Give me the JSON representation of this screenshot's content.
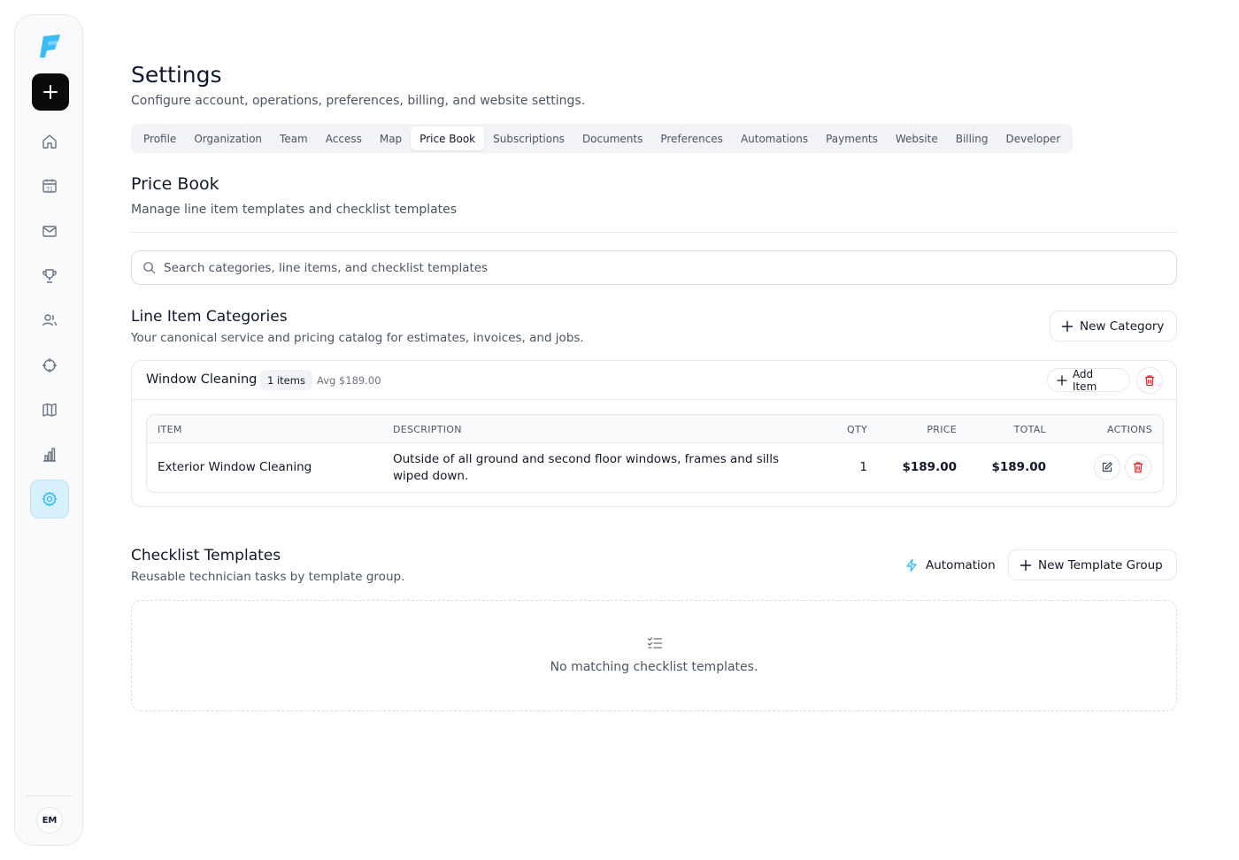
{
  "sidebar": {
    "nav_icons": [
      "home-icon",
      "calendar-icon",
      "mail-icon",
      "trophy-icon",
      "users-icon",
      "target-icon",
      "map-icon",
      "chart-icon",
      "settings-icon"
    ],
    "calendar_day": "31",
    "avatar_initials": "EM",
    "accent_color": "#38bdf8"
  },
  "header": {
    "title": "Settings",
    "subtitle": "Configure account, operations, preferences, billing, and website settings."
  },
  "tabs": [
    {
      "label": "Profile",
      "active": false
    },
    {
      "label": "Organization",
      "active": false
    },
    {
      "label": "Team",
      "active": false
    },
    {
      "label": "Access",
      "active": false
    },
    {
      "label": "Map",
      "active": false
    },
    {
      "label": "Price Book",
      "active": true
    },
    {
      "label": "Subscriptions",
      "active": false
    },
    {
      "label": "Documents",
      "active": false
    },
    {
      "label": "Preferences",
      "active": false
    },
    {
      "label": "Automations",
      "active": false
    },
    {
      "label": "Payments",
      "active": false
    },
    {
      "label": "Website",
      "active": false
    },
    {
      "label": "Billing",
      "active": false
    },
    {
      "label": "Developer",
      "active": false
    }
  ],
  "price_book": {
    "title": "Price Book",
    "subtitle": "Manage line item templates and checklist templates",
    "search_placeholder": "Search categories, line items, and checklist templates"
  },
  "line_items": {
    "title": "Line Item Categories",
    "subtitle": "Your canonical service and pricing catalog for estimates, invoices, and jobs.",
    "new_category_label": "New Category",
    "category": {
      "name": "Window Cleaning",
      "items_badge": "1 items",
      "avg": "Avg $189.00",
      "add_item_label": "Add Item"
    },
    "table": {
      "headers": {
        "item": "ITEM",
        "description": "DESCRIPTION",
        "qty": "QTY",
        "price": "PRICE",
        "total": "TOTAL",
        "actions": "ACTIONS"
      },
      "rows": [
        {
          "item": "Exterior Window Cleaning",
          "description_line1": "Outside of all ground and second floor windows, frames and sills",
          "description_line2": "wiped down.",
          "qty": "1",
          "price": "$189.00",
          "total": "$189.00"
        }
      ]
    }
  },
  "checklists": {
    "title": "Checklist Templates",
    "subtitle": "Reusable technician tasks by template group.",
    "automation_label": "Automation",
    "new_group_label": "New Template Group",
    "empty_text": "No matching checklist templates."
  },
  "colors": {
    "danger": "#dc2626",
    "accent": "#38bdf8"
  }
}
